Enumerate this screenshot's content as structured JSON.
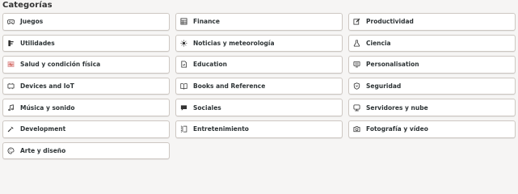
{
  "section": {
    "title": "Categorías"
  },
  "categories": [
    {
      "label": "Juegos",
      "icon": "gamepad-icon"
    },
    {
      "label": "Finance",
      "icon": "spreadsheet-icon"
    },
    {
      "label": "Productividad",
      "icon": "edit-icon"
    },
    {
      "label": "Utilidades",
      "icon": "utilities-icon"
    },
    {
      "label": "Noticias y meteorología",
      "icon": "weather-icon"
    },
    {
      "label": "Ciencia",
      "icon": "flask-icon"
    },
    {
      "label": "Salud y condición física",
      "icon": "heart-rate-icon"
    },
    {
      "label": "Education",
      "icon": "education-icon"
    },
    {
      "label": "Personalisation",
      "icon": "personalisation-icon"
    },
    {
      "label": "Devices and IoT",
      "icon": "device-icon"
    },
    {
      "label": "Books and Reference",
      "icon": "book-icon"
    },
    {
      "label": "Seguridad",
      "icon": "shield-icon"
    },
    {
      "label": "Música y sonido",
      "icon": "music-note-icon"
    },
    {
      "label": "Sociales",
      "icon": "chat-icon"
    },
    {
      "label": "Servidores y nube",
      "icon": "server-icon"
    },
    {
      "label": "Development",
      "icon": "development-icon"
    },
    {
      "label": "Entretenimiento",
      "icon": "entertainment-icon"
    },
    {
      "label": "Fotografía y vídeo",
      "icon": "camera-icon"
    },
    {
      "label": "Arte y diseño",
      "icon": "palette-icon"
    }
  ]
}
